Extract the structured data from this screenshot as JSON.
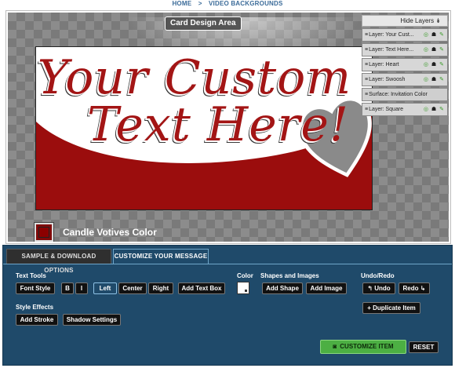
{
  "breadcrumb": {
    "home": "HOME",
    "separator": ">",
    "current": "VIDEO BACKGROUNDS"
  },
  "stage": {
    "title": "Card Design Area",
    "card": {
      "line1": "Your Custom",
      "line2": "Text Here!",
      "text_color": "#a31515",
      "swoosh_color": "#9b0d0d",
      "heart_color": "#8a8a8a"
    },
    "color_label": "Candle Votives Color",
    "swatch_color": "#8b0000"
  },
  "layers": {
    "hide_label": "Hide Layers",
    "items": [
      {
        "label": "Layer: Your Cust..."
      },
      {
        "label": "Layer: Text Here..."
      },
      {
        "label": "Layer: Heart"
      },
      {
        "label": "Layer: Swoosh"
      },
      {
        "label": "Surface: Invitation Color"
      },
      {
        "label": "Layer: Square"
      }
    ]
  },
  "panel": {
    "tabs": {
      "sample": "SAMPLE & DOWNLOAD OPTIONS",
      "customize": "CUSTOMIZE YOUR MESSAGE"
    },
    "text_tools": {
      "label": "Text Tools",
      "font_style": "Font Style",
      "bold": "B",
      "italic": "I",
      "left": "Left",
      "center": "Center",
      "right": "Right",
      "add_text_box": "Add Text Box"
    },
    "color": {
      "label": "Color"
    },
    "shapes": {
      "label": "Shapes and Images",
      "add_shape": "Add Shape",
      "add_image": "Add Image"
    },
    "undo_redo": {
      "label": "Undo/Redo",
      "undo": "Undo",
      "redo": "Redo",
      "duplicate": "Duplicate Item"
    },
    "style_effects": {
      "label": "Style Effects",
      "add_stroke": "Add Stroke",
      "shadow_settings": "Shadow Settings"
    },
    "customize_item": "CUSTOMIZE ITEM",
    "reset": "RESET"
  }
}
